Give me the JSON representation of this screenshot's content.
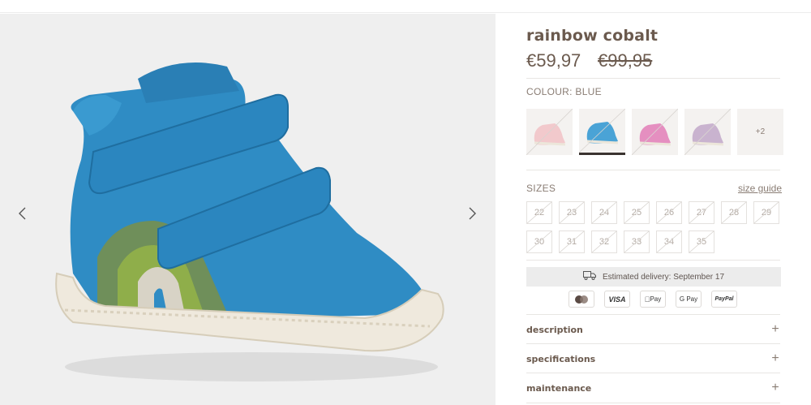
{
  "product": {
    "name": "rainbow cobalt",
    "price": "€59,97",
    "old_price": "€99,95"
  },
  "colour": {
    "label": "COLOUR: BLUE",
    "swatches": [
      {
        "name": "pink",
        "color": "#f2c9cc",
        "selected": false
      },
      {
        "name": "blue",
        "color": "#4aa3d6",
        "selected": true
      },
      {
        "name": "magenta",
        "color": "#e58fc0",
        "selected": false
      },
      {
        "name": "lavender",
        "color": "#c9b3cf",
        "selected": false
      }
    ],
    "more": "+2"
  },
  "sizes": {
    "label": "SIZES",
    "guide": "size guide",
    "items": [
      "22",
      "23",
      "24",
      "25",
      "26",
      "27",
      "28",
      "29",
      "30",
      "31",
      "32",
      "33",
      "34",
      "35"
    ]
  },
  "delivery": {
    "text": "Estimated delivery: September 17",
    "icon": "truck-icon"
  },
  "payments": [
    "",
    "VISA",
    "Pay",
    "G Pay",
    "PayPal"
  ],
  "accordion": {
    "description": "description",
    "specifications": "specifications",
    "maintenance": "maintenance"
  },
  "colors": {
    "shoe_blue": "#2f8cc4",
    "sole": "#efe9dd",
    "text": "#6b5a4e"
  }
}
